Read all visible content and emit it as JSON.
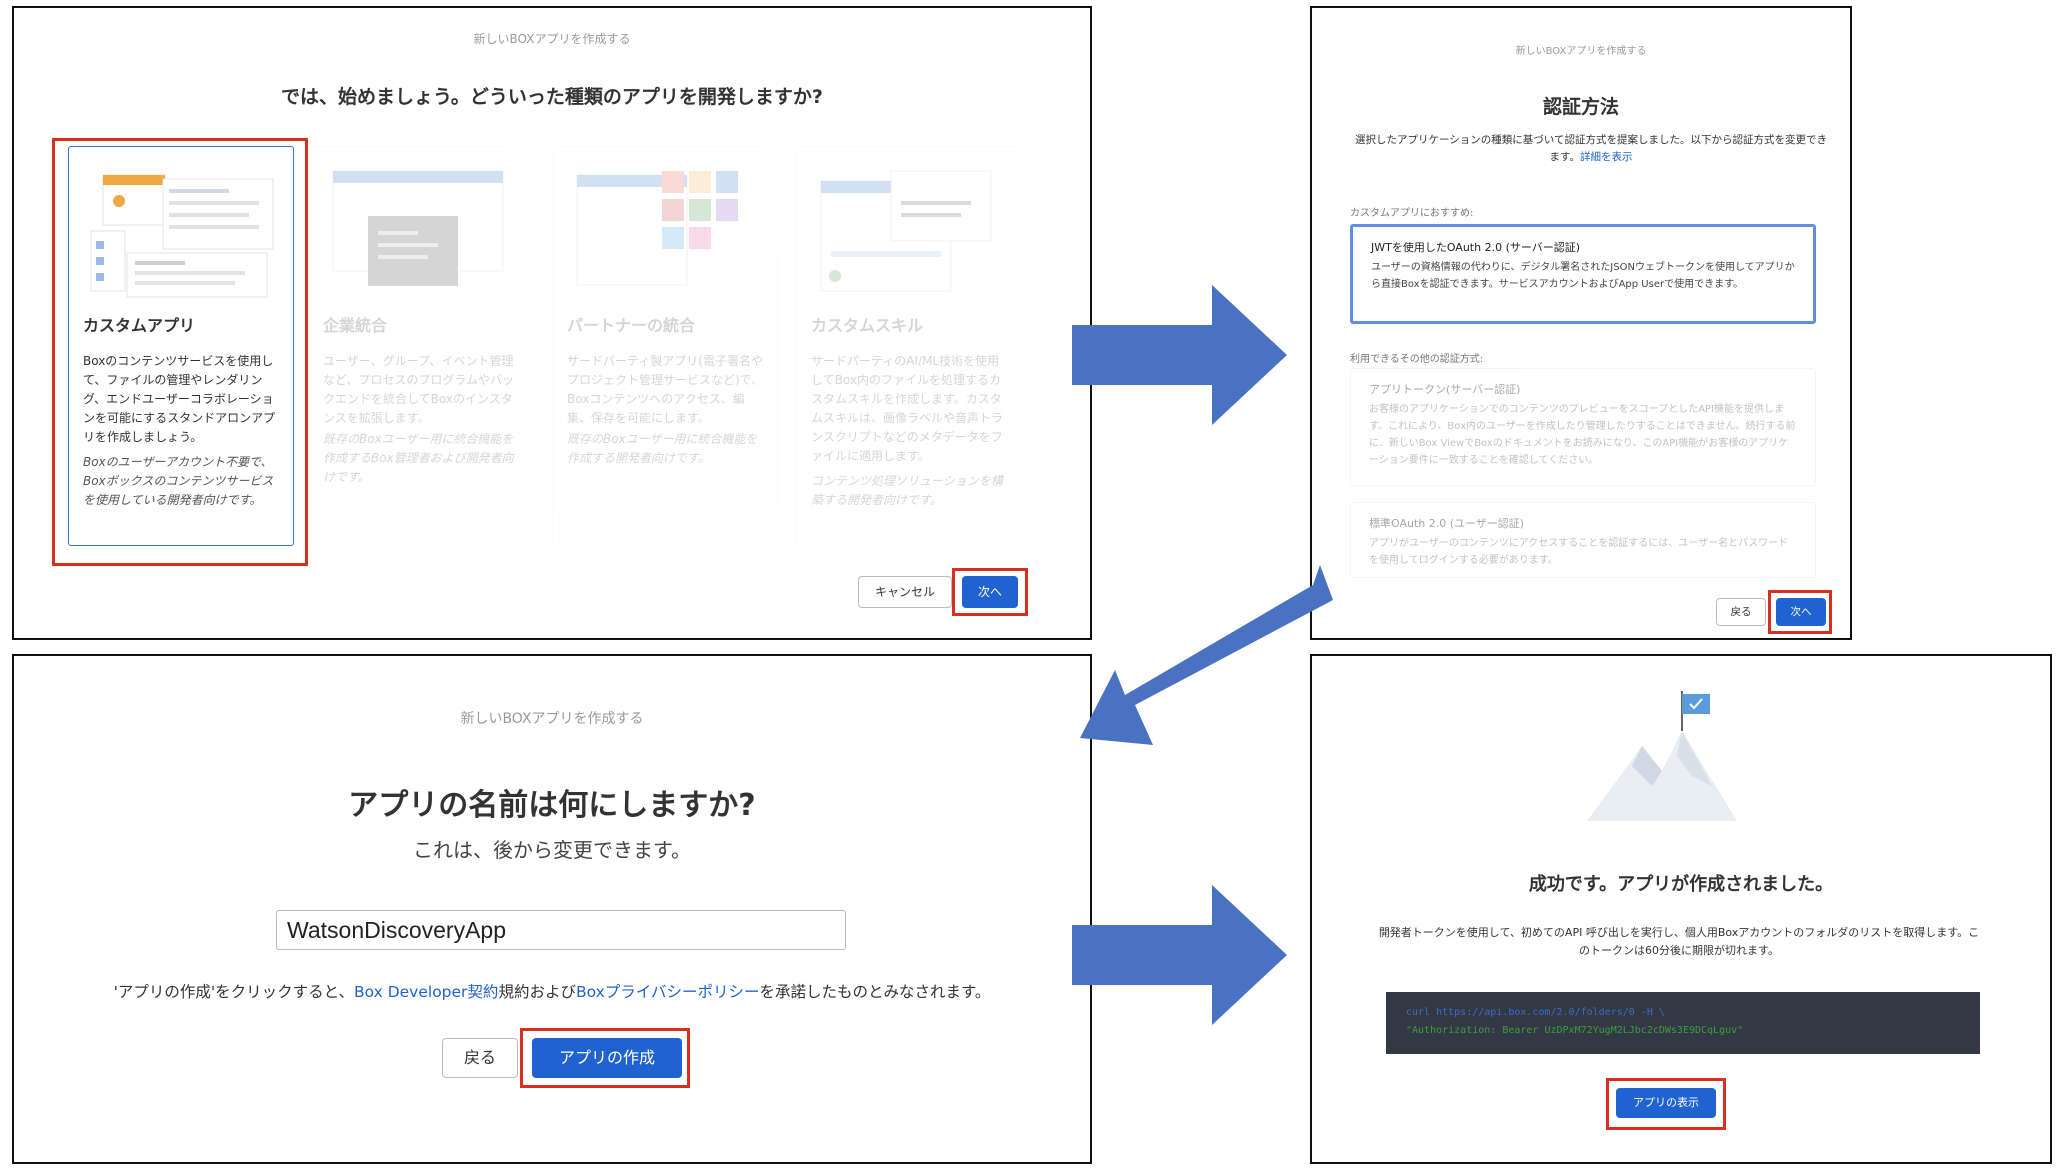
{
  "panel1": {
    "header": "新しいBOXアプリを作成する",
    "question": "では、始めましょう。どういった種類のアプリを開発しますか?",
    "cards": [
      {
        "title": "カスタムアプリ",
        "desc": "Boxのコンテンツサービスを使用して、ファイルの管理やレンダリング、エンドユーザーコラボレーションを可能にするスタンドアロンアプリを作成しましょう。",
        "note": "Boxのユーザーアカウント不要で、Boxボックスのコンテンツサービスを使用している開発者向けです。"
      },
      {
        "title": "企業統合",
        "desc": "ユーザー、グループ、イベント管理など、プロセスのプログラムやバックエンドを統合してBoxのインスタンスを拡張します。",
        "note": "既存のBoxユーザー用に統合機能を作成するBox管理者および開発者向けです。"
      },
      {
        "title": "パートナーの統合",
        "desc": "サードパーティ製アプリ(電子署名やプロジェクト管理サービスなど)で、Boxコンテンツへのアクセス、編集、保存を可能にします。",
        "note": "既存のBoxユーザー用に統合機能を作成する開発者向けです。"
      },
      {
        "title": "カスタムスキル",
        "desc": "サードパーティのAI/ML技術を使用してBox内のファイルを処理するカスタムスキルを作成します。カスタムスキルは、画像ラベルや音声トランスクリプトなどのメタデータをファイルに適用します。",
        "note": "コンテンツ処理ソリューションを構築する開発者向けです。"
      }
    ],
    "cancel_label": "キャンセル",
    "next_label": "次へ"
  },
  "panel2": {
    "header": "新しいBOXアプリを作成する",
    "title": "認証方法",
    "desc": "選択したアプリケーションの種類に基づいて認証方式を提案しました。以下から認証方式を変更できます。",
    "link": "詳細を表示",
    "recommended_label": "カスタムアプリにおすすめ:",
    "options": [
      {
        "title": "JWTを使用したOAuth 2.0 (サーバー認証)",
        "desc": "ユーザーの資格情報の代わりに、デジタル署名されたJSONウェブトークンを使用してアプリから直接Boxを認証できます。サービスアカウントおよびApp Userで使用できます。"
      },
      {
        "title": "アプリトークン(サーバー認証)",
        "desc": "お客様のアプリケーションでのコンテンツのプレビューをスコープとしたAPI機能を提供します。これにより、Box内のユーザーを作成したり管理したりすることはできません。続行する前に、新しいBox ViewでBoxのドキュメントをお読みになり、このAPI機能がお客様のアプリケーション要件に一致することを確認してください。"
      },
      {
        "title": "標準OAuth 2.0 (ユーザー認証)",
        "desc": "アプリがユーザーのコンテンツにアクセスすることを認証するには、ユーザー名とパスワードを使用してログインする必要があります。"
      }
    ],
    "other_label": "利用できるその他の認証方式:",
    "back_label": "戻る",
    "next_label": "次へ"
  },
  "panel3": {
    "header": "新しいBOXアプリを作成する",
    "title": "アプリの名前は何にしますか?",
    "subtitle": "これは、後から変更できます。",
    "app_name_value": "WatsonDiscoveryApp",
    "terms_prefix": "'アプリの作成'をクリックすると、",
    "terms_link1": "Box Developer契約",
    "terms_mid": "規約および",
    "terms_link2": "Boxプライバシーポリシー",
    "terms_suffix": "を承諾したものとみなされます。",
    "back_label": "戻る",
    "create_label": "アプリの作成"
  },
  "panel4": {
    "title": "成功です。アプリが作成されました。",
    "desc": "開発者トークンを使用して、初めてのAPI 呼び出しを実行し、個人用Boxアカウントのフォルダのリストを取得します。このトークンは60分後に期限が切れます。",
    "code_line1": "curl https://api.box.com/2.0/folders/0 -H \\",
    "code_line2": "\"Authorization: Bearer UzDPxM72YugM2LJbc2cDWs3E9DCqLguv\"",
    "view_label": "アプリの表示"
  },
  "colors": {
    "accent_blue": "#1f62d0",
    "highlight_red": "#d9301e",
    "arrow_blue": "#4a72c2",
    "code_bg": "#323844",
    "code_blue": "#3f6bc7",
    "code_green": "#3f9d3f"
  }
}
